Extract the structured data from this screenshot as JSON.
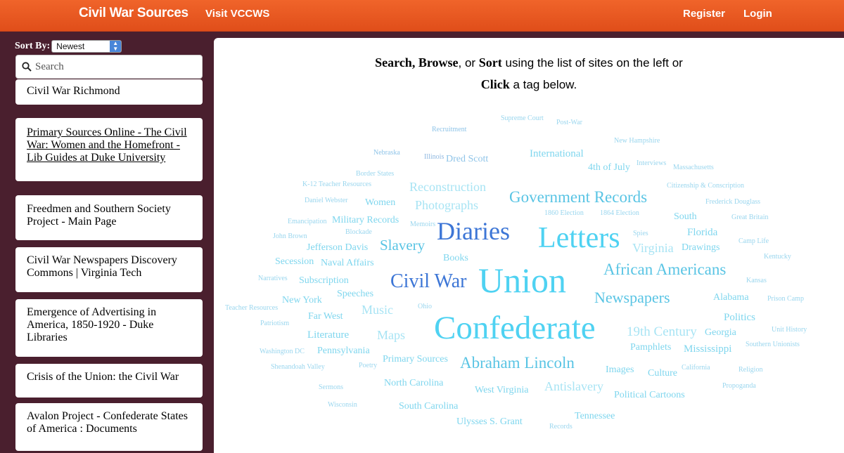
{
  "header": {
    "brand": "Civil War Sources",
    "visit_link": "Visit VCCWS",
    "register": "Register",
    "login": "Login"
  },
  "sidebar": {
    "sort_label": "Sort By:",
    "sort_value": "Newest",
    "search_placeholder": "Search",
    "sites": [
      "Civil War Richmond",
      "Primary Sources Online - The Civil War: Women and the Homefront - Lib Guides at Duke University",
      "Freedmen and Southern Society Project - Main Page",
      "Civil War Newspapers Discovery Commons | Virginia Tech",
      "Emergence of Advertising in America, 1850-1920 - Duke Libraries",
      "Crisis of the Union: the Civil War",
      "Avalon Project - Confederate States of America : Documents"
    ]
  },
  "intro": {
    "search": "Search",
    "browse": "Browse",
    "or1": ", or ",
    "sort": "Sort",
    "line1_rest": " using the list of sites on the left or",
    "click": "Click",
    "line2_rest": " a tag below."
  },
  "colors": {
    "header": "#e8561f",
    "sidebar": "#4a1f2e",
    "tag_dark": "#3d76d6",
    "tag_cyan": "#4fd2f2",
    "tag_light": "#9ad6ee"
  },
  "tags": [
    "Supreme Court",
    "Post-War",
    "Recruitment",
    "New Hampshire",
    "Nebraska",
    "Illinois",
    "Dred Scott",
    "International",
    "Interviews",
    "4th of July",
    "Massachusetts",
    "Border States",
    "K-12 Teacher Resources",
    "Reconstruction",
    "Citizenship & Conscription",
    "Daniel Webster",
    "Women",
    "Photographs",
    "Government Records",
    "Frederick Douglass",
    "1860 Election",
    "1864 Election",
    "South",
    "Great Britain",
    "Emancipation",
    "Military Records",
    "Memoirs",
    "Blockade",
    "Diaries",
    "Letters",
    "Spies",
    "Florida",
    "John Brown",
    "Camp Life",
    "Jefferson Davis",
    "Slavery",
    "Virginia",
    "Drawings",
    "Books",
    "Kentucky",
    "Secession",
    "Naval Affairs",
    "African Americans",
    "Narratives",
    "Subscription",
    "Civil War",
    "Union",
    "Kansas",
    "Speeches",
    "Newspapers",
    "Alabama",
    "Prison Camp",
    "New York",
    "Teacher Resources",
    "Music",
    "Ohio",
    "Far West",
    "Politics",
    "Patriotism",
    "Confederate",
    "Literature",
    "Maps",
    "19th Century",
    "Georgia",
    "Unit History",
    "Pamphlets",
    "Mississippi",
    "Southern Unionists",
    "Washington DC",
    "Pennsylvania",
    "Primary Sources",
    "Abraham Lincoln",
    "Shenandoah Valley",
    "Poetry",
    "Images",
    "Culture",
    "California",
    "Religion",
    "Sermons",
    "North Carolina",
    "Antislavery",
    "West Virginia",
    "Propoganda",
    "Political Cartoons",
    "Wisconsin",
    "South Carolina",
    "Tennessee",
    "Ulysses S. Grant",
    "Records"
  ]
}
